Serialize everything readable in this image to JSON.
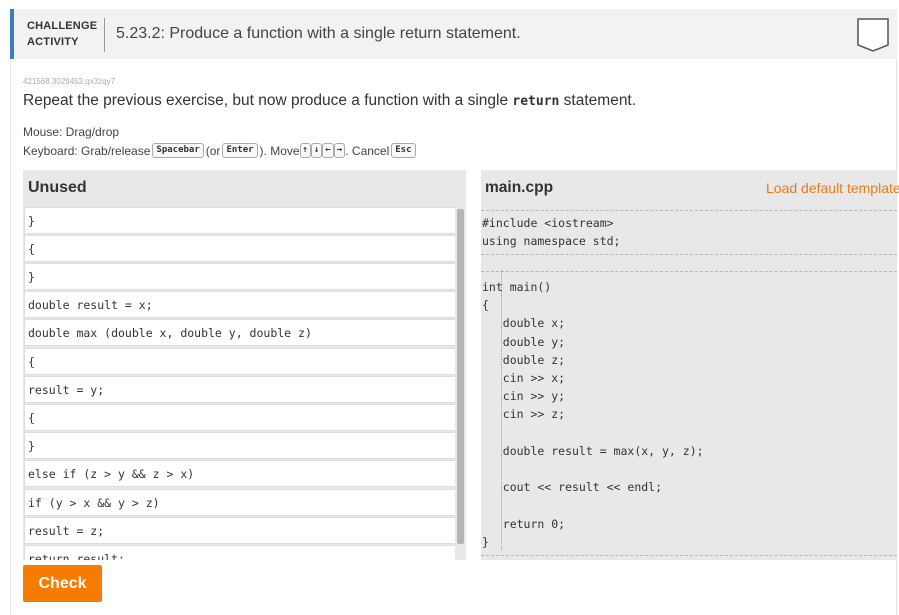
{
  "header": {
    "challenge_label_line1": "CHALLENGE",
    "challenge_label_line2": "ACTIVITY",
    "title": "5.23.2: Produce a function with a single return statement."
  },
  "activity_id": "421568.3029452.qx3zqy7",
  "instructions": {
    "before": "Repeat the previous exercise, but now produce a function with a single ",
    "code": "return",
    "after": " statement."
  },
  "help": {
    "mouse": "Mouse: Drag/drop",
    "keyboard_prefix": "Keyboard: Grab/release",
    "key_spacebar": "Spacebar",
    "or_open": "(or",
    "key_enter": "Enter",
    "move": "). Move",
    "key_up": "↑",
    "key_down": "↓",
    "key_left": "←",
    "key_right": "→",
    "cancel": ". Cancel",
    "key_esc": "Esc"
  },
  "unused": {
    "title": "Unused",
    "blocks": [
      "}",
      "{",
      "}",
      "double result = x;",
      "double max (double x, double y, double z)",
      "{",
      "result = y;",
      "{",
      "}",
      "else if (z > y && z > x)",
      "if (y > x && y > z)",
      "result = z;",
      "return result;"
    ]
  },
  "main_cpp": {
    "title": "main.cpp",
    "load_default": "Load default template",
    "header_lines": [
      "#include <iostream>",
      "using namespace std;"
    ],
    "main_lines": [
      "int main()",
      "{",
      "   double x;",
      "   double y;",
      "   double z;",
      "   cin >> x;",
      "   cin >> y;",
      "   cin >> z;",
      "",
      "   double result = max(x, y, z);",
      "",
      "   cout << result << endl;",
      "",
      "   return 0;",
      "}"
    ]
  },
  "check_button": "Check",
  "colors": {
    "accent": "#3a7ec2",
    "check": "#f57c00",
    "load_link": "#e77b1e",
    "keyword": "#2a6db8",
    "identifier": "#2a7a2a"
  }
}
